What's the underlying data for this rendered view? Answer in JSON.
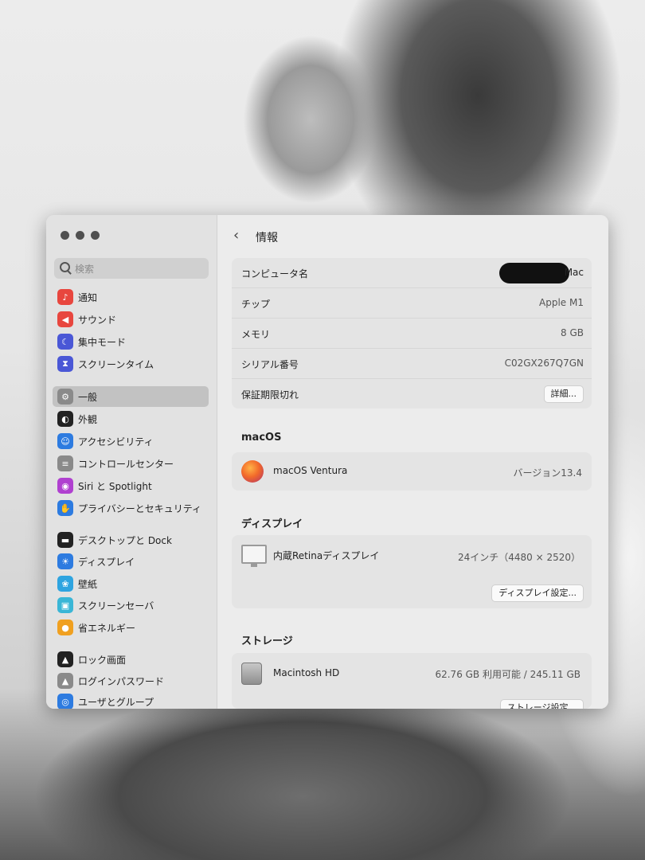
{
  "window": {
    "title": "情報",
    "search": {
      "placeholder": "検索"
    }
  },
  "sidebar": {
    "items": [
      {
        "label": "通知",
        "icon": "bell-icon",
        "color": "#e8463e"
      },
      {
        "label": "サウンド",
        "icon": "speaker-icon",
        "color": "#e8463e"
      },
      {
        "label": "集中モード",
        "icon": "moon-icon",
        "color": "#4a57d6"
      },
      {
        "label": "スクリーンタイム",
        "icon": "hourglass-icon",
        "color": "#4a57d6"
      },
      {
        "label": "一般",
        "icon": "gear-icon",
        "color": "#8a8a8a",
        "selected": true
      },
      {
        "label": "外観",
        "icon": "appearance-icon",
        "color": "#222222"
      },
      {
        "label": "アクセシビリティ",
        "icon": "accessibility-icon",
        "color": "#2d7be0"
      },
      {
        "label": "コントロールセンター",
        "icon": "toggles-icon",
        "color": "#8a8a8a"
      },
      {
        "label": "Siri と Spotlight",
        "icon": "siri-icon",
        "color": "#b040d0"
      },
      {
        "label": "プライバシーとセキュリティ",
        "icon": "hand-icon",
        "color": "#2d7be0"
      },
      {
        "label": "デスクトップと Dock",
        "icon": "dock-icon",
        "color": "#222222"
      },
      {
        "label": "ディスプレイ",
        "icon": "sun-icon",
        "color": "#2d7be0"
      },
      {
        "label": "壁紙",
        "icon": "flower-icon",
        "color": "#2ea4e0"
      },
      {
        "label": "スクリーンセーバ",
        "icon": "screensaver-icon",
        "color": "#3ab6d6"
      },
      {
        "label": "省エネルギー",
        "icon": "bulb-icon",
        "color": "#f0a020"
      },
      {
        "label": "ロック画面",
        "icon": "lock-icon",
        "color": "#222222"
      },
      {
        "label": "ログインパスワード",
        "icon": "lock-icon",
        "color": "#8a8a8a"
      },
      {
        "label": "ユーザとグループ",
        "icon": "users-icon",
        "color": "#2d7be0"
      }
    ]
  },
  "info": {
    "computer_name_label": "コンピュータ名",
    "computer_name_value": "Mac",
    "chip_label": "チップ",
    "chip_value": "Apple M1",
    "memory_label": "メモリ",
    "memory_value": "8 GB",
    "serial_label": "シリアル番号",
    "serial_value": "C02GX267Q7GN",
    "warranty_label": "保証期限切れ",
    "warranty_button": "詳細..."
  },
  "macos": {
    "heading": "macOS",
    "name": "macOS Ventura",
    "version": "バージョン13.4"
  },
  "display": {
    "heading": "ディスプレイ",
    "name": "内蔵Retinaディスプレイ",
    "spec": "24インチ（4480 × 2520）",
    "settings_button": "ディスプレイ設定..."
  },
  "storage": {
    "heading": "ストレージ",
    "name": "Macintosh HD",
    "detail": "62.76 GB 利用可能 / 245.11 GB",
    "settings_button": "ストレージ設定..."
  }
}
